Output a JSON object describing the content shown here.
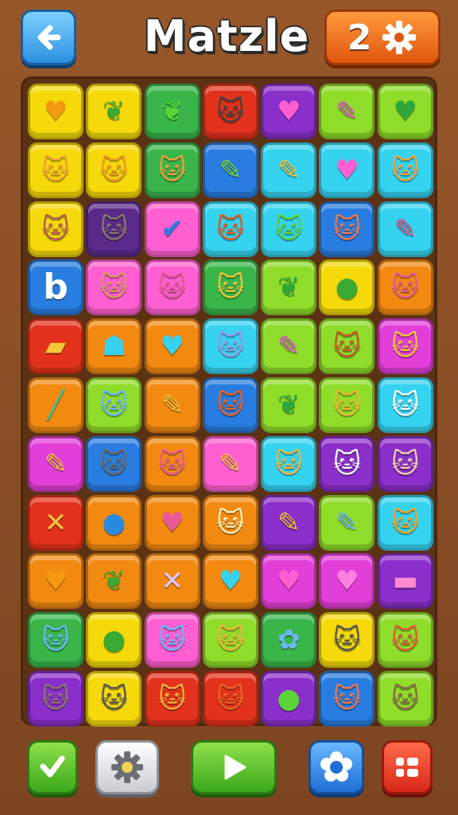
{
  "header": {
    "title": "Matzle",
    "level": "2"
  },
  "colors": {
    "yellow": "#f5d90a",
    "lime": "#8fdc2a",
    "green": "#39b54a",
    "red": "#e3321c",
    "purple": "#8a2fc9",
    "darkpurple": "#5a2a8a",
    "pink": "#ff5fd0",
    "cyan": "#36d3f0",
    "blue": "#2a7de0",
    "orange": "#f28a12",
    "magenta": "#e23fd8"
  },
  "board": {
    "rows": [
      [
        {
          "color": "yellow",
          "icon": "heart-icon",
          "glyph": "♥",
          "fg": "#f39a12"
        },
        {
          "color": "yellow",
          "icon": "leaf-icon",
          "glyph": "❦",
          "fg": "#3aa832"
        },
        {
          "color": "green",
          "icon": "leaf-icon",
          "glyph": "❦",
          "fg": "#5bd43a"
        },
        {
          "color": "red",
          "icon": "cat-face-icon",
          "glyph": "🐱",
          "fg": "#444"
        },
        {
          "color": "purple",
          "icon": "heart-icon",
          "glyph": "♥",
          "fg": "#ff5fd0"
        },
        {
          "color": "lime",
          "icon": "pencil-icon",
          "glyph": "✎",
          "fg": "#e05bc8"
        },
        {
          "color": "lime",
          "icon": "leaf-shield-icon",
          "glyph": "♥",
          "fg": "#2ea63a"
        }
      ],
      [
        {
          "color": "yellow",
          "icon": "cat-face-icon",
          "glyph": "🐱",
          "fg": "#f3a33a"
        },
        {
          "color": "yellow",
          "icon": "cat-face-icon",
          "glyph": "🐱",
          "fg": "#f39a2a"
        },
        {
          "color": "green",
          "icon": "cat-face-icon",
          "glyph": "🐱",
          "fg": "#f3a33a"
        },
        {
          "color": "blue",
          "icon": "pencil-icon",
          "glyph": "✎",
          "fg": "#7ed83a"
        },
        {
          "color": "cyan",
          "icon": "pencil-icon",
          "glyph": "✎",
          "fg": "#f5c53a"
        },
        {
          "color": "cyan",
          "icon": "heart-icon",
          "glyph": "♥",
          "fg": "#ff5fd0"
        },
        {
          "color": "cyan",
          "icon": "cat-face-icon",
          "glyph": "🐱",
          "fg": "#f3a33a"
        }
      ],
      [
        {
          "color": "yellow",
          "icon": "cat-face-icon",
          "glyph": "🐱",
          "fg": "#b85a5a"
        },
        {
          "color": "darkpurple",
          "icon": "cat-face-icon",
          "glyph": "🐱",
          "fg": "#8a7a6a"
        },
        {
          "color": "pink",
          "icon": "checkmark-icon",
          "glyph": "✔",
          "fg": "#2a7de0"
        },
        {
          "color": "cyan",
          "icon": "fox-face-icon",
          "glyph": "🐱",
          "fg": "#e85a1a"
        },
        {
          "color": "cyan",
          "icon": "cat-face-icon",
          "glyph": "🐱",
          "fg": "#5bd43a"
        },
        {
          "color": "blue",
          "icon": "cat-face-icon",
          "glyph": "🐱",
          "fg": "#f2784a"
        },
        {
          "color": "cyan",
          "icon": "pencil-icon",
          "glyph": "✎",
          "fg": "#e0508a"
        }
      ],
      [
        {
          "color": "blue",
          "icon": "letter-b-icon",
          "glyph": "b",
          "fg": "#ffffff"
        },
        {
          "color": "pink",
          "icon": "cat-face-icon",
          "glyph": "🐱",
          "fg": "#d89a5a"
        },
        {
          "color": "pink",
          "icon": "cat-face-icon",
          "glyph": "🐱",
          "fg": "#e85a9a"
        },
        {
          "color": "green",
          "icon": "cat-face-icon",
          "glyph": "🐱",
          "fg": "#f5c53a"
        },
        {
          "color": "lime",
          "icon": "leaf-icon",
          "glyph": "❦",
          "fg": "#2ea63a"
        },
        {
          "color": "yellow",
          "icon": "leaf-icon",
          "glyph": "●",
          "fg": "#3aa832"
        },
        {
          "color": "orange",
          "icon": "cat-face-icon",
          "glyph": "🐱",
          "fg": "#e85a9a"
        }
      ],
      [
        {
          "color": "red",
          "icon": "folder-icon",
          "glyph": "▰",
          "fg": "#f5c53a"
        },
        {
          "color": "orange",
          "icon": "helmet-icon",
          "glyph": "☗",
          "fg": "#36d3f0"
        },
        {
          "color": "orange",
          "icon": "heart-icon",
          "glyph": "♥",
          "fg": "#36d3f0"
        },
        {
          "color": "cyan",
          "icon": "cat-face-icon",
          "glyph": "🐱",
          "fg": "#9a9ae8"
        },
        {
          "color": "lime",
          "icon": "pencil-icon",
          "glyph": "✎",
          "fg": "#e05bc8"
        },
        {
          "color": "lime",
          "icon": "cat-face-icon",
          "glyph": "🐱",
          "fg": "#c8562a"
        },
        {
          "color": "magenta",
          "icon": "cat-face-icon",
          "glyph": "🐱",
          "fg": "#f5c53a"
        }
      ],
      [
        {
          "color": "orange",
          "icon": "pencil-icon",
          "glyph": "╱",
          "fg": "#36c0a0"
        },
        {
          "color": "lime",
          "icon": "cat-face-icon",
          "glyph": "🐱",
          "fg": "#6ab8ff"
        },
        {
          "color": "orange",
          "icon": "pencil-icon",
          "glyph": "✎",
          "fg": "#f5c53a"
        },
        {
          "color": "blue",
          "icon": "fox-face-icon",
          "glyph": "🐱",
          "fg": "#f2601a"
        },
        {
          "color": "lime",
          "icon": "leaf-icon",
          "glyph": "❦",
          "fg": "#2ea63a"
        },
        {
          "color": "lime",
          "icon": "cat-face-icon",
          "glyph": "🐱",
          "fg": "#f5b53a"
        },
        {
          "color": "cyan",
          "icon": "cat-face-icon",
          "glyph": "🐱",
          "fg": "#ffffff"
        }
      ],
      [
        {
          "color": "magenta",
          "icon": "pencil-icon",
          "glyph": "✎",
          "fg": "#f5c53a"
        },
        {
          "color": "blue",
          "icon": "cat-face-icon",
          "glyph": "🐱",
          "fg": "#6a6a6a"
        },
        {
          "color": "orange",
          "icon": "cat-face-icon",
          "glyph": "🐱",
          "fg": "#e85a9a"
        },
        {
          "color": "pink",
          "icon": "pencil-icon",
          "glyph": "✎",
          "fg": "#f5c53a"
        },
        {
          "color": "cyan",
          "icon": "cat-face-icon",
          "glyph": "🐱",
          "fg": "#f5b53a"
        },
        {
          "color": "purple",
          "icon": "cat-face-icon",
          "glyph": "🐱",
          "fg": "#ffffff"
        },
        {
          "color": "purple",
          "icon": "cat-face-icon",
          "glyph": "🐱",
          "fg": "#f2d2b0"
        }
      ],
      [
        {
          "color": "red",
          "icon": "cross-icon",
          "glyph": "✕",
          "fg": "#f5c53a"
        },
        {
          "color": "orange",
          "icon": "pumpkin-icon",
          "glyph": "●",
          "fg": "#2a8ae0"
        },
        {
          "color": "orange",
          "icon": "heart-icon",
          "glyph": "♥",
          "fg": "#e85a9a"
        },
        {
          "color": "orange",
          "icon": "cat-face-icon",
          "glyph": "🐱",
          "fg": "#fff3c0"
        },
        {
          "color": "purple",
          "icon": "pencil-icon",
          "glyph": "✎",
          "fg": "#f5c53a"
        },
        {
          "color": "lime",
          "icon": "pencil-icon",
          "glyph": "✎",
          "fg": "#6ab8ff"
        },
        {
          "color": "cyan",
          "icon": "cat-face-icon",
          "glyph": "🐱",
          "fg": "#f5a31a"
        }
      ],
      [
        {
          "color": "orange",
          "icon": "heart-icon",
          "glyph": "♥",
          "fg": "#f39a12"
        },
        {
          "color": "orange",
          "icon": "leaf-icon",
          "glyph": "❦",
          "fg": "#3aa832"
        },
        {
          "color": "orange",
          "icon": "cross-icon",
          "glyph": "✕",
          "fg": "#e0c8ff"
        },
        {
          "color": "orange",
          "icon": "heart-icon",
          "glyph": "♥",
          "fg": "#36d3f0"
        },
        {
          "color": "magenta",
          "icon": "heart-icon",
          "glyph": "♥",
          "fg": "#ff5fd0"
        },
        {
          "color": "magenta",
          "icon": "heart-icon",
          "glyph": "♥",
          "fg": "#ff80e0"
        },
        {
          "color": "purple",
          "icon": "card-icon",
          "glyph": "▬",
          "fg": "#ff8ad0"
        }
      ],
      [
        {
          "color": "green",
          "icon": "cat-face-icon",
          "glyph": "🐱",
          "fg": "#6ab8ff"
        },
        {
          "color": "yellow",
          "icon": "alien-icon",
          "glyph": "●",
          "fg": "#3aa832"
        },
        {
          "color": "pink",
          "icon": "cat-face-icon",
          "glyph": "🐱",
          "fg": "#6ab8ff"
        },
        {
          "color": "lime",
          "icon": "cat-face-icon",
          "glyph": "🐱",
          "fg": "#f5b53a"
        },
        {
          "color": "green",
          "icon": "flower-icon",
          "glyph": "✿",
          "fg": "#6ab8ff"
        },
        {
          "color": "yellow",
          "icon": "cat-face-icon",
          "glyph": "🐱",
          "fg": "#555"
        },
        {
          "color": "lime",
          "icon": "cat-face-icon",
          "glyph": "🐱",
          "fg": "#e85a3a"
        }
      ],
      [
        {
          "color": "purple",
          "icon": "cat-face-icon",
          "glyph": "🐱",
          "fg": "#8a7a6a"
        },
        {
          "color": "yellow",
          "icon": "cat-face-icon",
          "glyph": "🐱",
          "fg": "#555"
        },
        {
          "color": "red",
          "icon": "cat-face-icon",
          "glyph": "🐱",
          "fg": "#f5b53a"
        },
        {
          "color": "red",
          "icon": "cat-face-icon",
          "glyph": "🐱",
          "fg": "#e8682a"
        },
        {
          "color": "purple",
          "icon": "apple-icon",
          "glyph": "●",
          "fg": "#5bd43a"
        },
        {
          "color": "blue",
          "icon": "cat-face-icon",
          "glyph": "🐱",
          "fg": "#f2784a"
        },
        {
          "color": "lime",
          "icon": "cat-face-icon",
          "glyph": "🐱",
          "fg": "#8a6a4a"
        }
      ]
    ]
  },
  "footer": {
    "buttons": [
      "check-icon",
      "gear-icon",
      "play-icon",
      "flower-icon",
      "menu-icon"
    ]
  }
}
